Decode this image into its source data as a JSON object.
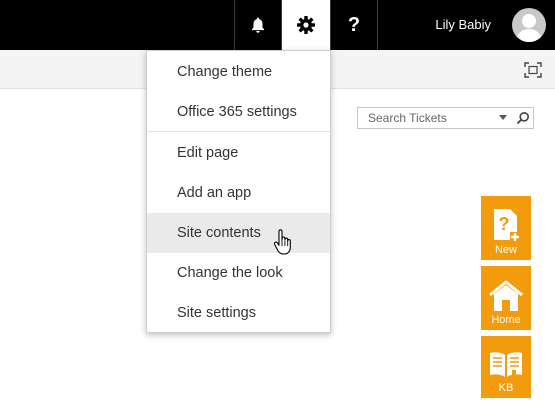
{
  "suitebar": {
    "user_name": "Lily Babiy",
    "background": "#000000",
    "icons": [
      "bell-icon",
      "gear-icon",
      "help-icon"
    ],
    "help_glyph": "?"
  },
  "search": {
    "placeholder": "Search Tickets"
  },
  "settings_menu": {
    "items": [
      {
        "label": "Change theme"
      },
      {
        "label": "Office 365 settings"
      },
      {
        "label": "Edit page"
      },
      {
        "label": "Add an app"
      },
      {
        "label": "Site contents",
        "hovered": true
      },
      {
        "label": "Change the look"
      },
      {
        "label": "Site settings"
      }
    ]
  },
  "side_tiles": {
    "accent": "#f29b0d",
    "new_label": "New",
    "home_label": "Home",
    "kb_label": "KB"
  }
}
